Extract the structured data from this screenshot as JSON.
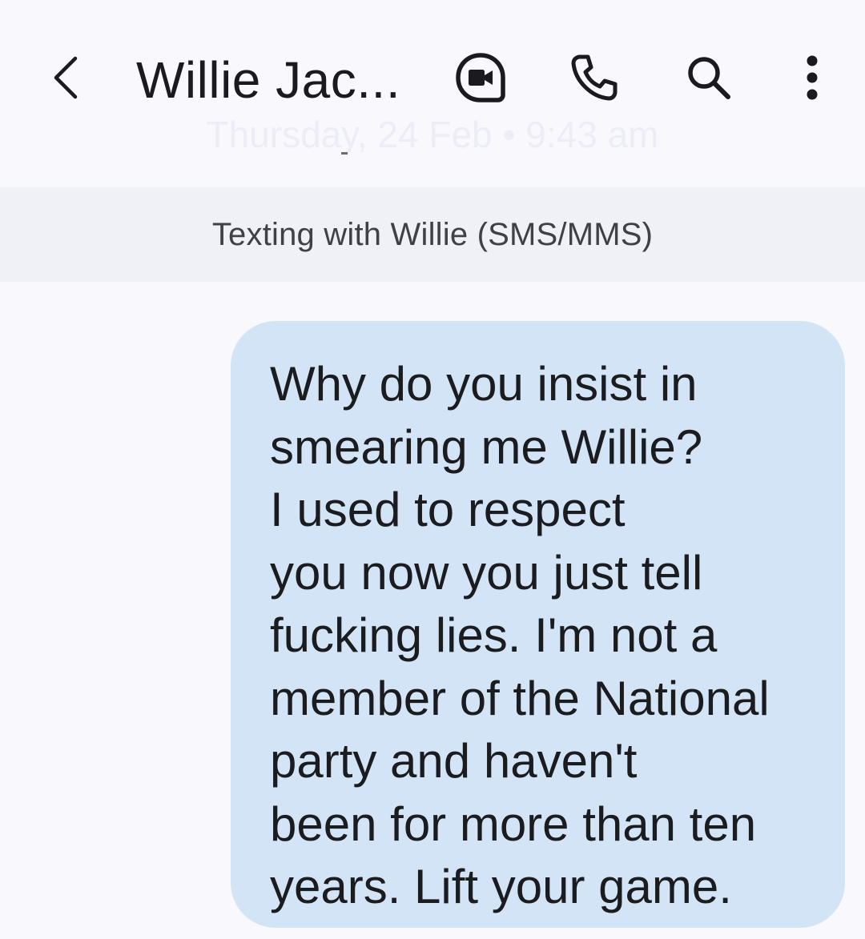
{
  "app_bar": {
    "back_icon": "chevron-left-icon",
    "contact_name": "Willie Jac...",
    "actions": [
      {
        "name": "video-call-button",
        "icon": "video-camera-icon"
      },
      {
        "name": "phone-call-button",
        "icon": "phone-icon"
      },
      {
        "name": "search-button",
        "icon": "search-icon"
      },
      {
        "name": "more-options-button",
        "icon": "more-vertical-icon"
      }
    ]
  },
  "ghost_date": "Thursday, 24 Feb • 9:43 am",
  "info_banner": {
    "text": "Texting with Willie (SMS/MMS)"
  },
  "message": {
    "direction": "outgoing",
    "bubble_color": "#d3e4f6",
    "lines": [
      "Why do you insist in",
      "smearing me Willie?",
      "I used to respect",
      "you now you just tell",
      "fucking lies. I'm not a",
      "member of the National",
      "party and haven't",
      "been for more than ten",
      "years. Lift your game."
    ]
  },
  "colors": {
    "background": "#f9f9fd",
    "banner": "#eff1f7",
    "icon": "#1b1b1f"
  }
}
